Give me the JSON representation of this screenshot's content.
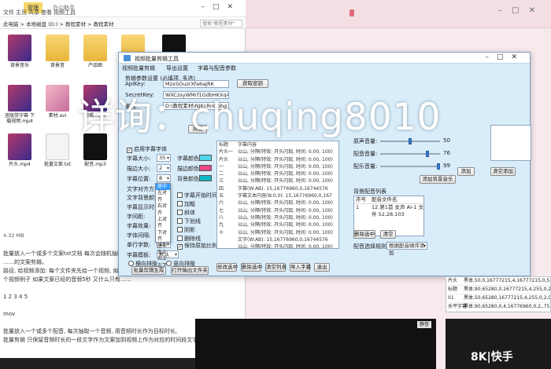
{
  "explorer": {
    "tab_manage": "管理",
    "tab_name": "办公助手",
    "ribbon": [
      "文件",
      "主页",
      "共享",
      "查看",
      "视频工具"
    ],
    "address": "此电脑 > 本地磁盘 (D:) > 教程素材 > 教程素材",
    "search_placeholder": "搜索\"教程素材\"",
    "files": [
      {
        "name": "背景音乐",
        "kind": "video"
      },
      {
        "name": "背景音",
        "kind": "folder"
      },
      {
        "name": "产品图",
        "kind": "folder"
      },
      {
        "name": "视频",
        "kind": "folder"
      },
      {
        "name": "",
        "kind": "dark"
      },
      {
        "name": "竖版带字幕 下载视频.mp4",
        "kind": "video"
      },
      {
        "name": "素材.avi",
        "kind": "pink"
      },
      {
        "name": "剪辑.mp4",
        "kind": "video"
      },
      {
        "name": "片头.mp4",
        "kind": "video"
      },
      {
        "name": "批量文案.txt",
        "kind": "doc"
      },
      {
        "name": "配音.mp3",
        "kind": "dark"
      }
    ],
    "status": "4.32 MB",
    "text_lines": [
      "批量放入一个或多个文案txt文档 每次会随机抽取",
      "……的文案剪辑。",
      "路径, 给视频添加: 每个文件夹先给一个视频, 如果……",
      "个视频例子 如果文案已经的音频5秒 又什么只有……",
      "",
      "1 2 3 4 5",
      "",
      "mov",
      "",
      "批量放入一个或多个配音, 每次抽取一个音频, 用音频时长作为目标时长,",
      "批量剪辑 只保留音频时长的一段文字作为文案加到视频上作为对应的时间段文字"
    ]
  },
  "dialog": {
    "title": "视频批量剪辑工具",
    "menu": [
      "视频批量剪辑",
      "导出设置",
      "字幕与配音参数"
    ],
    "section_title": "剪辑参数设置 (必填项, 多选)",
    "fields": {
      "api_label": "ApiKey:",
      "api_value": "MzxSOuzrXfa6aJRK",
      "api_btn": "获取密钥",
      "secret_label": "SecretKey:",
      "secret_value": "WXCzsyWMrf1GdbHKXq4bPsm",
      "path_label": "素材:",
      "path_value": "D:\\教程素材\\NJKcRnGphg",
      "test_btn": "测试"
    },
    "options": {
      "chk_auto": "启用字幕字体",
      "row1_label": "字幕大小:",
      "row1_value": "35",
      "row1_color_label": "字幕颜色:",
      "row2_label": "描边大小:",
      "row2_value": "2",
      "row2_color_label": "描边颜色:",
      "row3_label": "字幕位置:",
      "row3_value": "8",
      "row3_color_label": "背景颜色:",
      "row4_label": "文字对齐方式:",
      "row4_value": "居中",
      "opt_bold": "加粗",
      "opt_italic": "斜体",
      "opt_under": "下划线",
      "opt_shadow": "阴影",
      "opt_strike": "删除线",
      "opt_prefix": "字幕开始时间",
      "row5_label": "文字背景颜色:",
      "row6_label": "字幕显示时长:",
      "row7_label": "字间距:",
      "row8_label": "字幕效果:",
      "row9_label": "字体间隔:",
      "row10_label": "单行字数:",
      "row10_value": "11",
      "chk_keep": "保持原始比例",
      "row11_label": "字幕模板:",
      "row11_value": "默认",
      "radio_a": "横向排版",
      "radio_b": "竖向排版",
      "btn_start": "批量剪辑生成",
      "btn_open": "打开输出文件夹"
    },
    "dropdown_items": [
      "居中",
      "左对齐",
      "右对齐",
      "上对齐",
      "下对齐",
      "居中",
      "左上",
      "右上",
      "左下"
    ],
    "dropdown_selected_index": 0,
    "list_rows": [
      {
        "a": "标题",
        "b": "字幕内容"
      },
      {
        "a": "片头一",
        "b": "以山, 分隔(特效: 开头闪现, 时间: 0.00, 100)"
      },
      {
        "a": "片头",
        "b": "以山, 分隔(特效: 开头闪现, 时间: 0.00, 100)"
      },
      {
        "a": "一",
        "b": "以山, 分隔(特效: 开头闪现, 时间: 0.00, 100)"
      },
      {
        "a": "二",
        "b": "以山, 分隔(特效: 开头闪现, 时间: 0.00, 100)"
      },
      {
        "a": "三",
        "b": "以山, 分隔(特效: 开头闪现, 时间: 0.00, 100)"
      },
      {
        "a": "四",
        "b": "字幕(W:AB): 15,16776960,0,16744576"
      },
      {
        "a": "五",
        "b": "字幕文本内容(N:0,0): 15,16776960,0,167"
      },
      {
        "a": "六",
        "b": "以山, 分隔(特效: 开头闪现, 时间: 0.00, 100)"
      },
      {
        "a": "七",
        "b": "以山, 分隔(特效: 开头闪现, 时间: 0.00, 100)"
      },
      {
        "a": "八",
        "b": "以山, 分隔(特效: 开头闪现, 时间: 0.00, 100)"
      },
      {
        "a": "九",
        "b": "以山, 分隔(特效: 开头闪现, 时间: 0.00, 100)"
      },
      {
        "a": "十",
        "b": "以山, 分隔(特效: 开头闪现, 时间: 0.00, 100)"
      },
      {
        "a": "",
        "b": "文字(W:AB): 15,16776960,0,16744576"
      },
      {
        "a": "",
        "b": "以山, 分隔(特效: 开头闪现, 时间: 0.00, 100)"
      }
    ],
    "list_buttons": [
      "修改选中",
      "删除选中",
      "清空列表",
      "导入字幕",
      "退出"
    ],
    "right": {
      "vol1_label": "原声音量:",
      "vol1_value": "50",
      "vol2_label": "配音音量:",
      "vol2_value": "76",
      "vol3_label": "配乐音量:",
      "vol3_value": "99",
      "btn_add_bgm": "添加背景音乐",
      "btn_add": "添加",
      "btn_clear": "清空添加",
      "table_title": "背景配音列表",
      "table_head": [
        "序号",
        "配音文件名"
      ],
      "table_rows": [
        [
          "1",
          "12.第1首 女声 AI-1 文件 52,28,103"
        ]
      ],
      "btn_delete": "删除选中",
      "btn_empty": "清空",
      "mode_label": "配音选择规则:",
      "mode_value": "根据配音顺序添加"
    }
  },
  "low_table": [
    {
      "a": "片头",
      "b": "黑体,50,0,16777215,4,16777215,0,5,0"
    },
    {
      "a": "标题",
      "b": "黑体,90,65280,0,16777215,4,255,0,2,0"
    },
    {
      "a": "01",
      "b": "黑体,50,65280,16777215,4,255,0,2,0,5"
    },
    {
      "a": "水平字幕",
      "b": "黑体,90,65280,0,4,16776960,0,2,,75,0"
    }
  ],
  "black_btn": "静音",
  "logo": "8K|快手",
  "watermark": "详询：chuqing8010",
  "colors": {
    "dialog_bg": "#d8ecfa",
    "swatch_cyan": "#4fd6e8",
    "swatch_pink": "#e64a8a",
    "swatch_teal": "#12b5c4"
  }
}
